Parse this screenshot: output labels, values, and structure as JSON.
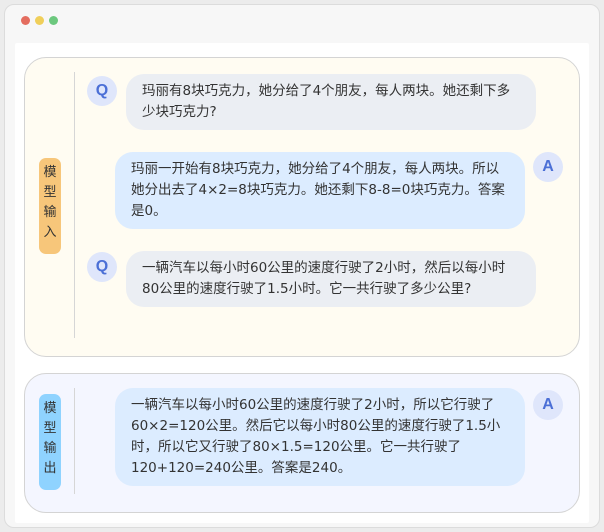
{
  "window_controls": [
    "close",
    "minimize",
    "maximize"
  ],
  "input_section": {
    "label": "模型输入",
    "label_chars": [
      "模",
      "型",
      "输",
      "入"
    ],
    "messages": [
      {
        "role_badge": "Q",
        "text": "玛丽有8块巧克力，她分给了4个朋友，每人两块。她还剩下多少块巧克力?"
      },
      {
        "role_badge": "A",
        "text": "玛丽一开始有8块巧克力，她分给了4个朋友，每人两块。所以她分出去了4×2=8块巧克力。她还剩下8-8=0块巧克力。答案是0。"
      },
      {
        "role_badge": "Q",
        "text": "一辆汽车以每小时60公里的速度行驶了2小时，然后以每小时80公里的速度行驶了1.5小时。它一共行驶了多少公里?"
      }
    ]
  },
  "output_section": {
    "label": "模型输出",
    "label_chars": [
      "模",
      "型",
      "输",
      "出"
    ],
    "messages": [
      {
        "role_badge": "A",
        "text": "一辆汽车以每小时60公里的速度行驶了2小时，所以它行驶了60×2=120公里。然后它以每小时80公里的速度行驶了1.5小时，所以它又行驶了80×1.5=120公里。它一共行驶了120+120=240公里。答案是240。"
      }
    ]
  },
  "colors": {
    "input_panel_bg": "#fffcf2",
    "output_panel_bg": "#f4f6ff",
    "input_tag_bg": "#f7c67a",
    "output_tag_bg": "#8fd3ff",
    "question_bubble_bg": "#ebeef3",
    "answer_bubble_bg": "#dcecff",
    "avatar_text": "#4b6fd6"
  }
}
